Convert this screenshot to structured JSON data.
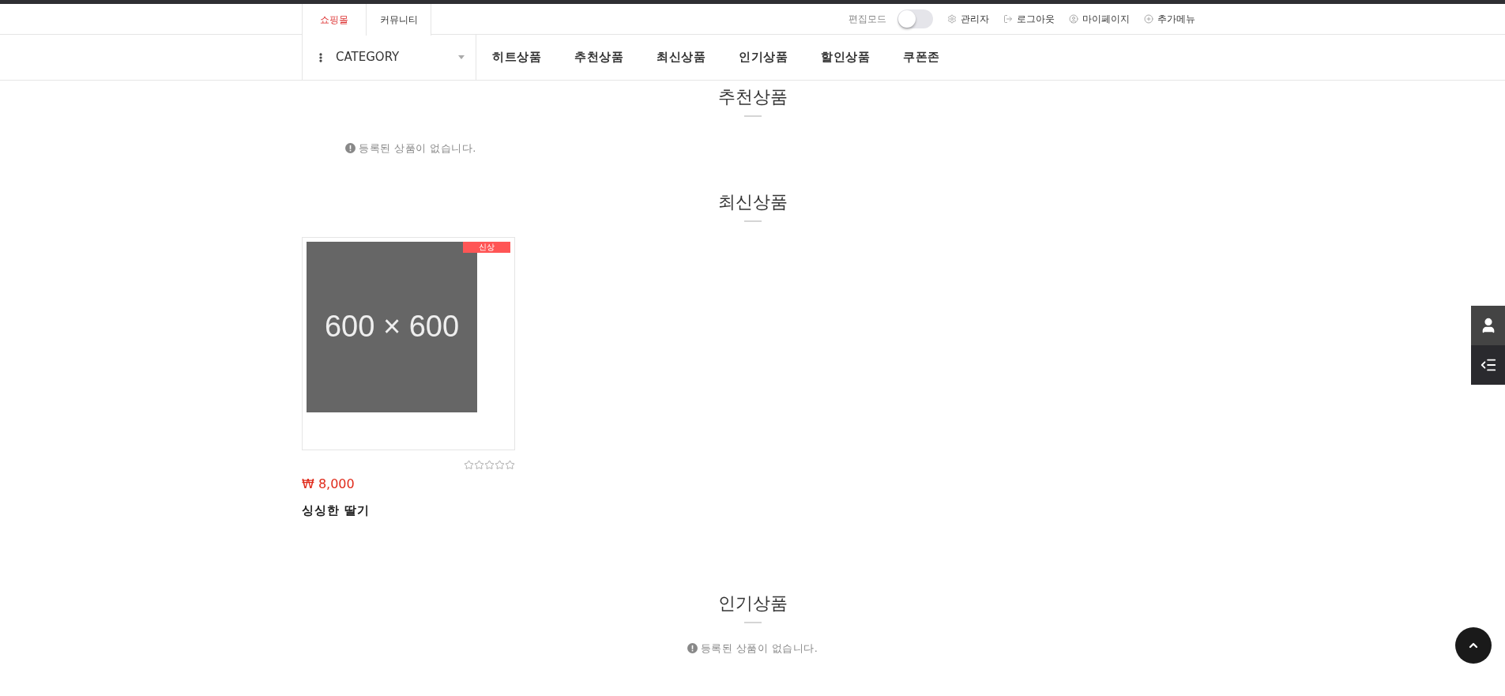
{
  "top_nav": {
    "tabs": [
      {
        "label": "쇼핑몰",
        "selected": true
      },
      {
        "label": "커뮤니티",
        "selected": false
      }
    ],
    "edit_mode": {
      "label": "편집모드",
      "on": false
    },
    "links": [
      {
        "label": "관리자",
        "kind": "gear"
      },
      {
        "label": "로그아웃",
        "kind": "logout"
      },
      {
        "label": "마이페이지",
        "kind": "user"
      },
      {
        "label": "추가메뉴",
        "kind": "plus"
      }
    ]
  },
  "category_nav": {
    "category_label": "CATEGORY",
    "items": [
      "히트상품",
      "추천상품",
      "최신상품",
      "인기상품",
      "할인상품",
      "쿠폰존"
    ]
  },
  "sections": [
    {
      "title": "추천상품",
      "empty_message": "등록된 상품이 없습니다."
    },
    {
      "title": "최신상품",
      "products": [
        {
          "image_text": "600 × 600",
          "badge": "신상",
          "stars": 0,
          "price": "₩ 8,000",
          "name": "싱싱한 딸기"
        }
      ]
    },
    {
      "title": "인기상품",
      "empty_message": "등록된 상품이 없습니다."
    }
  ]
}
